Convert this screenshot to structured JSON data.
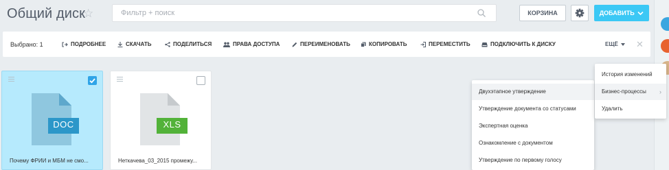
{
  "header": {
    "title": "Общий диск",
    "filter_placeholder": "Фильтр + поиск",
    "trash_label": "КОРЗИНА",
    "add_label": "ДОБАВИТЬ"
  },
  "toolbar": {
    "selected": "Выбрано: 1",
    "items": [
      "ПОДРОБНЕЕ",
      "СКАЧАТЬ",
      "ПОДЕЛИТЬСЯ",
      "ПРАВА ДОСТУПА",
      "ПЕРЕИМЕНОВАТЬ",
      "КОПИРОВАТЬ",
      "ПЕРЕМЕСТИТЬ",
      "ПОДКЛЮЧИТЬ К ДИСКУ"
    ],
    "more": "ЕЩЁ"
  },
  "files": [
    {
      "type": "DOC",
      "name": "Почему ФРИИ и МБМ не смо...",
      "checked": true
    },
    {
      "type": "XLS",
      "name": "Неткачева_03_2015 промежу...",
      "checked": false
    }
  ],
  "context_menu": {
    "items": [
      "История изменений",
      "Бизнес-процессы",
      "Удалить"
    ]
  },
  "submenu": {
    "items": [
      "Двухэтапное утверждение",
      "Утверждение документа со статусами",
      "Экспертная оценка",
      "Ознакомление с документом",
      "Утверждение по первому голосу"
    ]
  },
  "colors": {
    "accent": "#3bc8f5",
    "selected_card": "#b6eafd",
    "doc": "#2c97c9",
    "xls": "#52b239"
  }
}
